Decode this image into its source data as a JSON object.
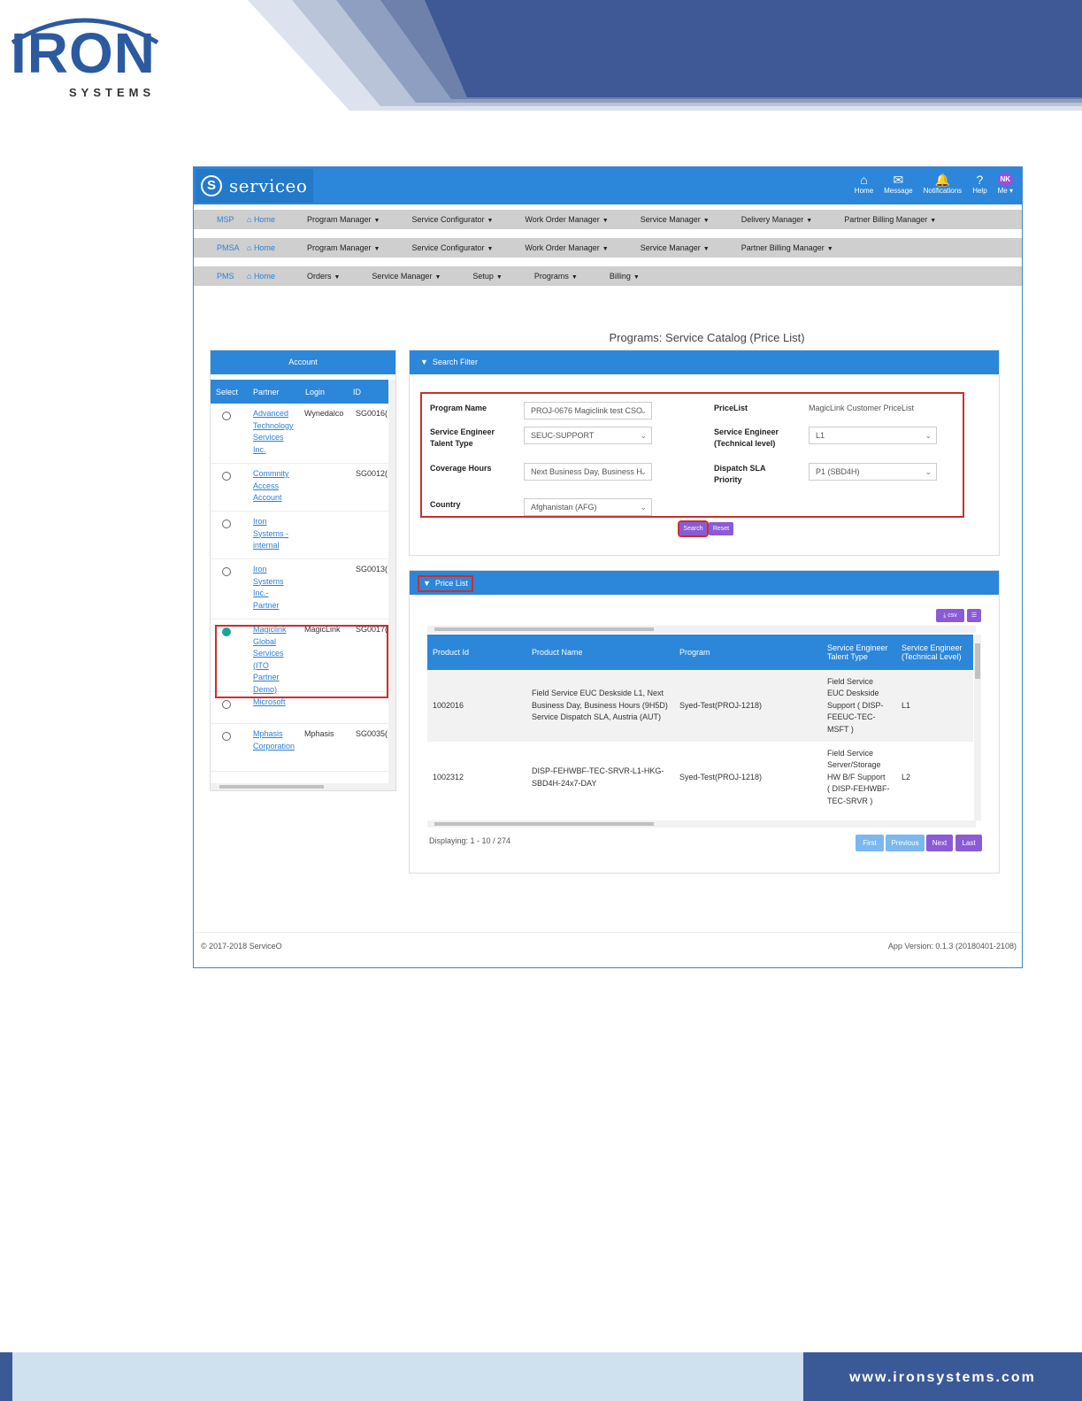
{
  "doc": {
    "brand_word": "IRON",
    "brand_sub": "SYSTEMS",
    "footer_url": "www.ironsystems.com"
  },
  "app": {
    "brand": "serviceo",
    "top_icons": [
      {
        "label": "Home",
        "icon": "home-icon"
      },
      {
        "label": "Message",
        "icon": "message-icon"
      },
      {
        "label": "Notifications",
        "icon": "bell-icon"
      },
      {
        "label": "Help",
        "icon": "help-icon"
      },
      {
        "label": "Me",
        "icon": "avatar"
      }
    ],
    "avatar_initials": "NK",
    "nav_rows": [
      {
        "tag": "MSP",
        "home": "Home",
        "items": [
          "Program Manager",
          "Service Configurator",
          "Work Order Manager",
          "Service Manager",
          "Delivery Manager",
          "Partner Billing Manager"
        ]
      },
      {
        "tag": "PMSA",
        "home": "Home",
        "items": [
          "Program Manager",
          "Service Configurator",
          "Work Order Manager",
          "Service Manager",
          "Partner Billing Manager"
        ]
      },
      {
        "tag": "PMS",
        "home": "Home",
        "items": [
          "Orders",
          "Service Manager",
          "Setup",
          "Programs",
          "Billing"
        ]
      }
    ],
    "page_title": "Programs: Service Catalog (Price List)",
    "account": {
      "title": "Account",
      "columns": [
        "Select",
        "Partner",
        "Login",
        "ID"
      ],
      "rows": [
        {
          "partner": [
            "Advanced",
            "Technology",
            "Services",
            "Inc."
          ],
          "login": "Wynedalco",
          "id": "SG0016(",
          "selected": false
        },
        {
          "partner": [
            "Commnity",
            "Access",
            "Account"
          ],
          "login": "",
          "id": "SG0012(",
          "selected": false
        },
        {
          "partner": [
            "Iron",
            "Systems -",
            "internal"
          ],
          "login": "",
          "id": "",
          "selected": false
        },
        {
          "partner": [
            "Iron",
            "Systems",
            "Inc.-",
            "Partner"
          ],
          "login": "",
          "id": "SG0013(",
          "selected": false
        },
        {
          "partner": [
            "Magiclink",
            "Global",
            "Services",
            "(ITO",
            "Partner",
            "Demo)"
          ],
          "login": "MagicLink",
          "id": "SG0017(",
          "selected": true
        },
        {
          "partner": [
            "Microsoft"
          ],
          "login": "",
          "id": "",
          "selected": false
        },
        {
          "partner": [
            "Mphasis",
            "Corporation"
          ],
          "login": "Mphasis",
          "id": "SG0035(",
          "selected": false
        }
      ]
    },
    "search_filter": {
      "title": "Search Filter",
      "program_name_label": "Program Name",
      "program_name_value": "PROJ-0676 Magiclink test CSO",
      "pricelist_label": "PriceList",
      "pricelist_value": "MagicLink Customer PriceList",
      "talent_type_label": [
        "Service Engineer",
        "Talent Type"
      ],
      "talent_type_value": "SEUC-SUPPORT",
      "tech_level_label": [
        "Service Engineer",
        "(Technical level)"
      ],
      "tech_level_value": "L1",
      "coverage_label": "Coverage Hours",
      "coverage_value": "Next Business Day, Business H",
      "sla_label": [
        "Dispatch SLA",
        "Priority"
      ],
      "sla_value": "P1 (SBD4H)",
      "country_label": "Country",
      "country_value": "Afghanistan (AFG)",
      "search_button": "Search",
      "reset_button": "Reset"
    },
    "price_list": {
      "title": "Price List",
      "csv_button": "csv",
      "columns": [
        "Product Id",
        "Product Name",
        "Program",
        [
          "Service Engineer",
          "Talent Type"
        ],
        [
          "Service Engineer",
          "(Technical Level)"
        ]
      ],
      "rows": [
        {
          "product_id": "1002016",
          "product_name": [
            "Field Service EUC Deskside L1, Next",
            "Business Day, Business Hours (9H5D)",
            "Service Dispatch SLA, Austria (AUT)"
          ],
          "program": "Syed-Test(PROJ-1218)",
          "talent": [
            "Field Service",
            "EUC Deskside",
            "Support ( DISP-",
            "FEEUC-TEC-",
            "MSFT )"
          ],
          "level": "L1"
        },
        {
          "product_id": "1002312",
          "product_name": [
            "DISP-FEHWBF-TEC-SRVR-L1-HKG-",
            "SBD4H-24x7-DAY"
          ],
          "program": "Syed-Test(PROJ-1218)",
          "talent": [
            "Field Service",
            "Server/Storage",
            "HW B/F Support",
            "( DISP-FEHWBF-",
            "TEC-SRVR )"
          ],
          "level": "L2"
        }
      ],
      "displaying": "Displaying: 1 - 10 / 274",
      "pager": [
        "First",
        "Previous",
        "Next",
        "Last"
      ]
    },
    "footer_left": "© 2017-2018 ServiceO",
    "footer_right": "App Version: 0.1.3 (20180401-2108)"
  }
}
